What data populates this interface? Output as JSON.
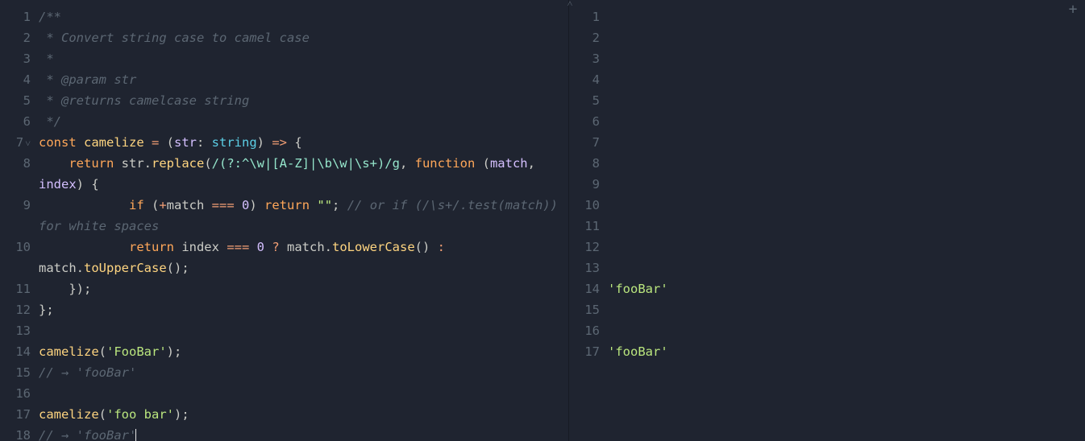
{
  "left": {
    "lines": [
      {
        "n": "1",
        "segs": [
          {
            "cls": "t-com",
            "t": "/**"
          }
        ]
      },
      {
        "n": "2",
        "segs": [
          {
            "cls": "t-com",
            "t": " * Convert string case to camel case"
          }
        ]
      },
      {
        "n": "3",
        "segs": [
          {
            "cls": "t-com",
            "t": " *"
          }
        ]
      },
      {
        "n": "4",
        "segs": [
          {
            "cls": "t-com",
            "t": " * @param str"
          }
        ]
      },
      {
        "n": "5",
        "segs": [
          {
            "cls": "t-com",
            "t": " * @returns camelcase string"
          }
        ]
      },
      {
        "n": "6",
        "segs": [
          {
            "cls": "t-com",
            "t": " */"
          }
        ]
      },
      {
        "n": "7",
        "fold": true,
        "segs": [
          {
            "cls": "t-kw",
            "t": "const "
          },
          {
            "cls": "t-fn",
            "t": "camelize"
          },
          {
            "cls": "t-op",
            "t": " = "
          },
          {
            "cls": "t-pun",
            "t": "("
          },
          {
            "cls": "t-par",
            "t": "str"
          },
          {
            "cls": "t-pun",
            "t": ": "
          },
          {
            "cls": "t-type",
            "t": "string"
          },
          {
            "cls": "t-pun",
            "t": ") "
          },
          {
            "cls": "t-op",
            "t": "=>"
          },
          {
            "cls": "t-pun",
            "t": " {"
          }
        ]
      },
      {
        "n": "8",
        "segs": [
          {
            "cls": "t-pun",
            "t": "    "
          },
          {
            "cls": "t-kw",
            "t": "return "
          },
          {
            "cls": "t-var",
            "t": "str"
          },
          {
            "cls": "t-pun",
            "t": "."
          },
          {
            "cls": "t-fn",
            "t": "replace"
          },
          {
            "cls": "t-pun",
            "t": "("
          },
          {
            "cls": "t-regex",
            "t": "/(?:^\\w|[A-Z]|\\b\\w|\\s+)/g"
          },
          {
            "cls": "t-pun",
            "t": ", "
          },
          {
            "cls": "t-kw",
            "t": "function"
          },
          {
            "cls": "t-pun",
            "t": " ("
          },
          {
            "cls": "t-par",
            "t": "match"
          },
          {
            "cls": "t-pun",
            "t": ", "
          },
          {
            "cls": "t-par",
            "t": "index"
          },
          {
            "cls": "t-pun",
            "t": ") {"
          }
        ]
      },
      {
        "n": "9",
        "segs": [
          {
            "cls": "t-pun",
            "t": "            "
          },
          {
            "cls": "t-kw",
            "t": "if"
          },
          {
            "cls": "t-pun",
            "t": " ("
          },
          {
            "cls": "t-op",
            "t": "+"
          },
          {
            "cls": "t-var",
            "t": "match"
          },
          {
            "cls": "t-op",
            "t": " === "
          },
          {
            "cls": "t-num",
            "t": "0"
          },
          {
            "cls": "t-pun",
            "t": ") "
          },
          {
            "cls": "t-kw",
            "t": "return"
          },
          {
            "cls": "t-pun",
            "t": " "
          },
          {
            "cls": "t-str",
            "t": "\"\""
          },
          {
            "cls": "t-pun",
            "t": "; "
          },
          {
            "cls": "t-com",
            "t": "// or if (/\\s+/.test(match)) for white spaces"
          }
        ]
      },
      {
        "n": "10",
        "segs": [
          {
            "cls": "t-pun",
            "t": "            "
          },
          {
            "cls": "t-kw",
            "t": "return "
          },
          {
            "cls": "t-var",
            "t": "index"
          },
          {
            "cls": "t-op",
            "t": " === "
          },
          {
            "cls": "t-num",
            "t": "0"
          },
          {
            "cls": "t-op",
            "t": " ? "
          },
          {
            "cls": "t-var",
            "t": "match"
          },
          {
            "cls": "t-pun",
            "t": "."
          },
          {
            "cls": "t-fn",
            "t": "toLowerCase"
          },
          {
            "cls": "t-pun",
            "t": "()"
          },
          {
            "cls": "t-op",
            "t": " : "
          },
          {
            "cls": "t-var",
            "t": "match"
          },
          {
            "cls": "t-pun",
            "t": "."
          },
          {
            "cls": "t-fn",
            "t": "toUpperCase"
          },
          {
            "cls": "t-pun",
            "t": "();"
          }
        ]
      },
      {
        "n": "11",
        "segs": [
          {
            "cls": "t-pun",
            "t": "    });"
          }
        ]
      },
      {
        "n": "12",
        "segs": [
          {
            "cls": "t-pun",
            "t": "};"
          }
        ]
      },
      {
        "n": "13",
        "segs": [
          {
            "cls": "t-pun",
            "t": ""
          }
        ]
      },
      {
        "n": "14",
        "segs": [
          {
            "cls": "t-fn",
            "t": "camelize"
          },
          {
            "cls": "t-pun",
            "t": "("
          },
          {
            "cls": "t-str",
            "t": "'FooBar'"
          },
          {
            "cls": "t-pun",
            "t": ");"
          }
        ]
      },
      {
        "n": "15",
        "segs": [
          {
            "cls": "t-com",
            "t": "// → 'fooBar'"
          }
        ]
      },
      {
        "n": "16",
        "segs": [
          {
            "cls": "t-pun",
            "t": ""
          }
        ]
      },
      {
        "n": "17",
        "segs": [
          {
            "cls": "t-fn",
            "t": "camelize"
          },
          {
            "cls": "t-pun",
            "t": "("
          },
          {
            "cls": "t-str",
            "t": "'foo bar'"
          },
          {
            "cls": "t-pun",
            "t": ");"
          }
        ]
      },
      {
        "n": "18",
        "cursor": true,
        "segs": [
          {
            "cls": "t-com",
            "t": "// → 'fooBar'"
          }
        ]
      }
    ]
  },
  "right": {
    "lines": [
      {
        "n": "1",
        "segs": []
      },
      {
        "n": "2",
        "segs": []
      },
      {
        "n": "3",
        "segs": []
      },
      {
        "n": "4",
        "segs": []
      },
      {
        "n": "5",
        "segs": []
      },
      {
        "n": "6",
        "segs": []
      },
      {
        "n": "7",
        "segs": []
      },
      {
        "n": "8",
        "segs": []
      },
      {
        "n": "9",
        "segs": []
      },
      {
        "n": "10",
        "segs": []
      },
      {
        "n": "11",
        "segs": []
      },
      {
        "n": "12",
        "segs": []
      },
      {
        "n": "13",
        "segs": []
      },
      {
        "n": "14",
        "segs": [
          {
            "cls": "t-str",
            "t": "'fooBar'"
          }
        ]
      },
      {
        "n": "15",
        "segs": []
      },
      {
        "n": "16",
        "segs": []
      },
      {
        "n": "17",
        "segs": [
          {
            "cls": "t-str",
            "t": "'fooBar'"
          }
        ]
      }
    ]
  },
  "icons": {
    "splitter": "˄",
    "plus": "+"
  }
}
